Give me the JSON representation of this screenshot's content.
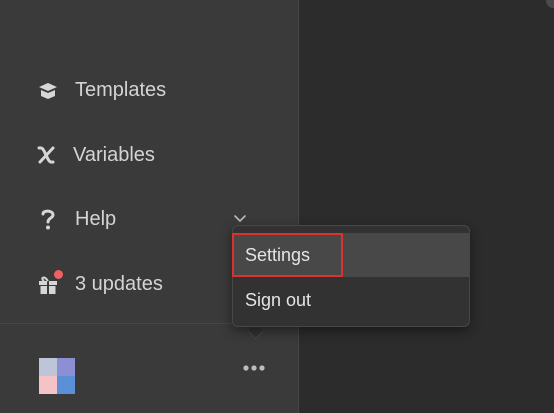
{
  "sidebar": {
    "items": [
      {
        "label": "Templates",
        "icon": "templates-box-icon"
      },
      {
        "label": "Variables",
        "icon": "variable-x-icon"
      },
      {
        "label": "Help",
        "icon": "question-icon"
      },
      {
        "label": "3 updates",
        "icon": "gift-icon"
      }
    ]
  },
  "menu": {
    "items": [
      {
        "label": "Settings",
        "selected": true
      },
      {
        "label": "Sign out"
      }
    ]
  },
  "colors": {
    "sidebar_bg": "#3a3a3a",
    "main_bg": "#2c2c2c",
    "highlight": "#d9332b",
    "badge": "#f26161"
  }
}
